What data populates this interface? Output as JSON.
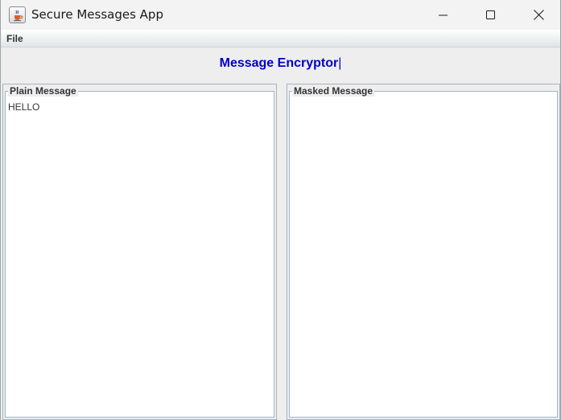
{
  "window": {
    "title": "Secure Messages App",
    "app_icon": "java-cup-icon",
    "controls": [
      "minimize-icon",
      "maximize-icon",
      "close-icon"
    ]
  },
  "menubar": {
    "items": [
      {
        "label": "File"
      }
    ]
  },
  "header": {
    "title": "Message Encryptor",
    "caret": "|",
    "title_color": "#0000cc"
  },
  "panels": {
    "plain": {
      "label": "Plain Message",
      "content": "HELLO"
    },
    "masked": {
      "label": "Masked Message",
      "content": ""
    }
  }
}
